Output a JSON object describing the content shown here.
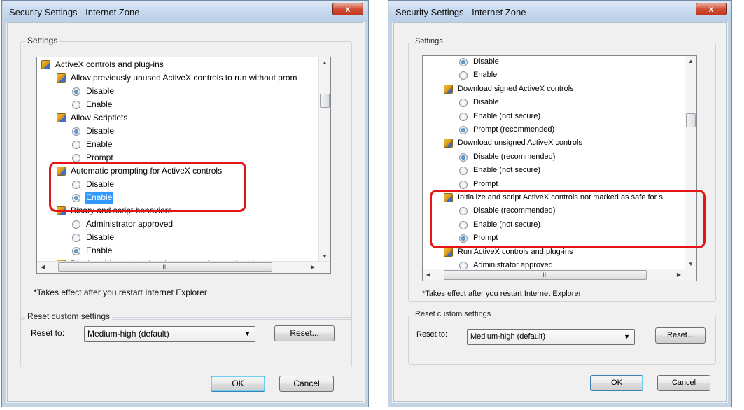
{
  "left_dialog": {
    "title": "Security Settings - Internet Zone",
    "close_label": "x",
    "settings_label": "Settings",
    "rows": [
      {
        "kind": "cat",
        "text": "ActiveX controls and plug-ins"
      },
      {
        "kind": "sub",
        "text": "Allow previously unused ActiveX controls to run without prom"
      },
      {
        "kind": "opt",
        "text": "Disable",
        "checked": true
      },
      {
        "kind": "opt",
        "text": "Enable",
        "checked": false
      },
      {
        "kind": "sub",
        "text": "Allow Scriptlets"
      },
      {
        "kind": "opt",
        "text": "Disable",
        "checked": true
      },
      {
        "kind": "opt",
        "text": "Enable",
        "checked": false
      },
      {
        "kind": "opt",
        "text": "Prompt",
        "checked": false
      },
      {
        "kind": "sub",
        "text": "Automatic prompting for ActiveX controls"
      },
      {
        "kind": "opt",
        "text": "Disable",
        "checked": false
      },
      {
        "kind": "opt",
        "text": "Enable",
        "checked": true,
        "selected": true
      },
      {
        "kind": "sub",
        "text": "Binary and script behaviors"
      },
      {
        "kind": "opt",
        "text": "Administrator approved",
        "checked": false
      },
      {
        "kind": "opt",
        "text": "Disable",
        "checked": false
      },
      {
        "kind": "opt",
        "text": "Enable",
        "checked": true
      },
      {
        "kind": "sub",
        "text": "Display video and animation on a webpage that does not use"
      }
    ],
    "hscroll_thumb": "III",
    "note": "*Takes effect after you restart Internet Explorer",
    "reset_group_label": "Reset custom settings",
    "reset_to_label": "Reset to:",
    "reset_select_value": "Medium-high (default)",
    "reset_button": "Reset...",
    "ok_button": "OK",
    "cancel_button": "Cancel"
  },
  "right_dialog": {
    "title": "Security Settings - Internet Zone",
    "close_label": "x",
    "settings_label": "Settings",
    "rows": [
      {
        "kind": "opt",
        "text": "Disable",
        "checked": true
      },
      {
        "kind": "opt",
        "text": "Enable",
        "checked": false
      },
      {
        "kind": "sub",
        "text": "Download signed ActiveX controls"
      },
      {
        "kind": "opt",
        "text": "Disable",
        "checked": false
      },
      {
        "kind": "opt",
        "text": "Enable (not secure)",
        "checked": false
      },
      {
        "kind": "opt",
        "text": "Prompt (recommended)",
        "checked": true
      },
      {
        "kind": "sub",
        "text": "Download unsigned ActiveX controls"
      },
      {
        "kind": "opt",
        "text": "Disable (recommended)",
        "checked": true
      },
      {
        "kind": "opt",
        "text": "Enable (not secure)",
        "checked": false
      },
      {
        "kind": "opt",
        "text": "Prompt",
        "checked": false
      },
      {
        "kind": "sub",
        "text": "Initialize and script ActiveX controls not marked as safe for s"
      },
      {
        "kind": "opt",
        "text": "Disable (recommended)",
        "checked": false
      },
      {
        "kind": "opt",
        "text": "Enable (not secure)",
        "checked": false
      },
      {
        "kind": "opt",
        "text": "Prompt",
        "checked": true
      },
      {
        "kind": "sub",
        "text": "Run ActiveX controls and plug-ins"
      },
      {
        "kind": "opt",
        "text": "Administrator approved",
        "checked": false
      }
    ],
    "hscroll_thumb": "III",
    "note": "*Takes effect after you restart Internet Explorer",
    "reset_group_label": "Reset custom settings",
    "reset_to_label": "Reset to:",
    "reset_select_value": "Medium-high (default)",
    "reset_button": "Reset...",
    "ok_button": "OK",
    "cancel_button": "Cancel"
  },
  "colors": {
    "highlight_box": "#e31515",
    "selection": "#3399ff",
    "dialog_bg": "#f0f0f0"
  }
}
